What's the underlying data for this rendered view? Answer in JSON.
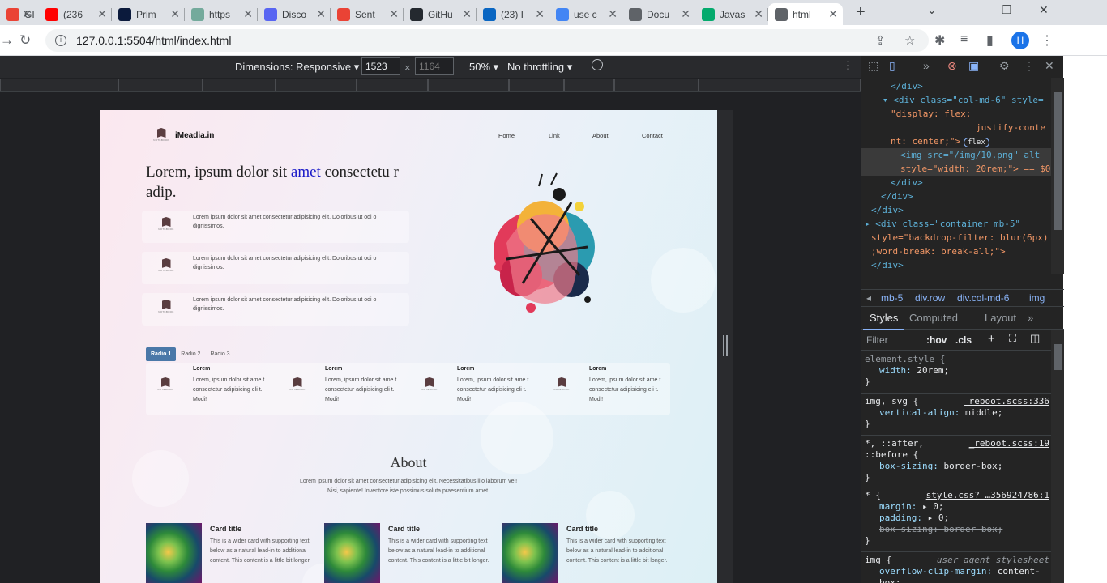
{
  "tabs": [
    {
      "favicon": "gmail-icon",
      "title": "GI",
      "color": "#ea4335"
    },
    {
      "favicon": "youtube-icon",
      "title": "(236",
      "color": "#ff0000"
    },
    {
      "favicon": "prime-icon",
      "title": "Prim",
      "color": "#0b1a3c"
    },
    {
      "favicon": "chatgpt-icon",
      "title": "https",
      "color": "#74aa9c"
    },
    {
      "favicon": "discord-icon",
      "title": "Disco",
      "color": "#5865f2"
    },
    {
      "favicon": "gmail-icon",
      "title": "Sent",
      "color": "#ea4335"
    },
    {
      "favicon": "github-icon",
      "title": "GitHu",
      "color": "#24292f"
    },
    {
      "favicon": "linkedin-icon",
      "title": "(23) I",
      "color": "#0a66c2"
    },
    {
      "favicon": "google-icon",
      "title": "use c",
      "color": "#4285f4"
    },
    {
      "favicon": "globe-icon",
      "title": "Docu",
      "color": "#5f6368"
    },
    {
      "favicon": "w3schools-icon",
      "title": "Javas",
      "color": "#04aa6d"
    },
    {
      "favicon": "globe-icon",
      "title": "html",
      "color": "#5f6368",
      "active": true
    }
  ],
  "address": {
    "url": "127.0.0.1:5504/html/index.html",
    "avatar": "H"
  },
  "device_toolbar": {
    "dimensions": "Dimensions: Responsive",
    "width": "1523",
    "height_placeholder": "1164",
    "times": "×",
    "zoom": "50%",
    "throttling": "No throttling"
  },
  "site": {
    "brand": "iMeadia.in",
    "logo_caption": "NOTEBOOK",
    "nav": [
      "Home",
      "Link",
      "About",
      "Contact"
    ],
    "hero_pre": "Lorem, ipsum dolor sit ",
    "hero_blue": "amet",
    "hero_post": " consectetu r adip.",
    "features": [
      "Lorem ipsum dolor sit amet consectetur adipisicing elit. Doloribus ut odi o dignissimos.",
      "Lorem ipsum dolor sit amet consectetur adipisicing elit. Doloribus ut odi o dignissimos.",
      "Lorem ipsum dolor sit amet consectetur adipisicing elit. Doloribus ut odi o dignissimos."
    ],
    "radios": [
      "Radio 1",
      "Radio 2",
      "Radio 3"
    ],
    "radio_items": [
      {
        "title": "Lorem",
        "text": "Lorem, ipsum dolor sit ame t consectetur adipisicing eli t. Modi!"
      },
      {
        "title": "Lorem",
        "text": "Lorem, ipsum dolor sit ame t consectetur adipisicing eli t. Modi!"
      },
      {
        "title": "Lorem",
        "text": "Lorem, ipsum dolor sit ame t consectetur adipisicing eli t. Modi!"
      },
      {
        "title": "Lorem",
        "text": "Lorem, ipsum dolor sit ame t consectetur adipisicing eli t. Modi!"
      }
    ],
    "about_title": "About",
    "about_text": "Lorem ipsum dolor sit amet consectetur adipisicing elit. Necessitatibus illo laborum vel! Nisi, sapiente! Inventore iste possimus soluta praesentium amet.",
    "cards": [
      {
        "title": "Card title",
        "text": "This is a wider card with supporting text below as a natural lead-in to additional content. This content is a little bit longer."
      },
      {
        "title": "Card title",
        "text": "This is a wider card with supporting text below as a natural lead-in to additional content. This content is a little bit longer."
      },
      {
        "title": "Card title",
        "text": "This is a wider card with supporting text below as a natural lead-in to additional content. This content is a little bit longer."
      }
    ]
  },
  "devtools": {
    "elements": [
      "</div>",
      "<div class=\"col-md-6\" style=",
      "\"display: flex;",
      "justify-conte",
      "nt: center;\">",
      "<img src=\"/img/10.png\" alt",
      "style=\"width: 20rem;\"> == $0",
      "</div>",
      "</div>",
      "</div>",
      "<div class=\"container mb-5\"",
      "style=\"backdrop-filter: blur(6px)",
      ";word-break: break-all;\">",
      "</div>"
    ],
    "flex_badge": "flex",
    "breadcrumbs": [
      "mb-5",
      "div.row",
      "div.col-md-6",
      "img"
    ],
    "style_tabs": [
      "Styles",
      "Computed",
      "Layout"
    ],
    "filter_placeholder": "Filter",
    "hov": ":hov",
    "cls": ".cls",
    "rules": [
      {
        "selector": "element.style {",
        "source": "",
        "props": [
          [
            "width",
            "20rem;"
          ]
        ]
      },
      {
        "selector": "img, svg {",
        "source": "_reboot.scss:336",
        "props": [
          [
            "vertical-align",
            "middle;"
          ]
        ]
      },
      {
        "selector": "*, ::after, ::before {",
        "source": "_reboot.scss:19",
        "props": [
          [
            "box-sizing",
            "border-box;"
          ]
        ]
      },
      {
        "selector": "* {",
        "source": "style.css?_…356924786:1",
        "props": [
          [
            "margin",
            "▸ 0;"
          ],
          [
            "padding",
            "▸ 0;"
          ],
          [
            "box-sizing",
            "border-box;"
          ]
        ]
      },
      {
        "selector": "img {",
        "source": "user agent stylesheet",
        "props": [
          [
            "overflow-clip-margin",
            "content-box;"
          ]
        ]
      }
    ]
  }
}
